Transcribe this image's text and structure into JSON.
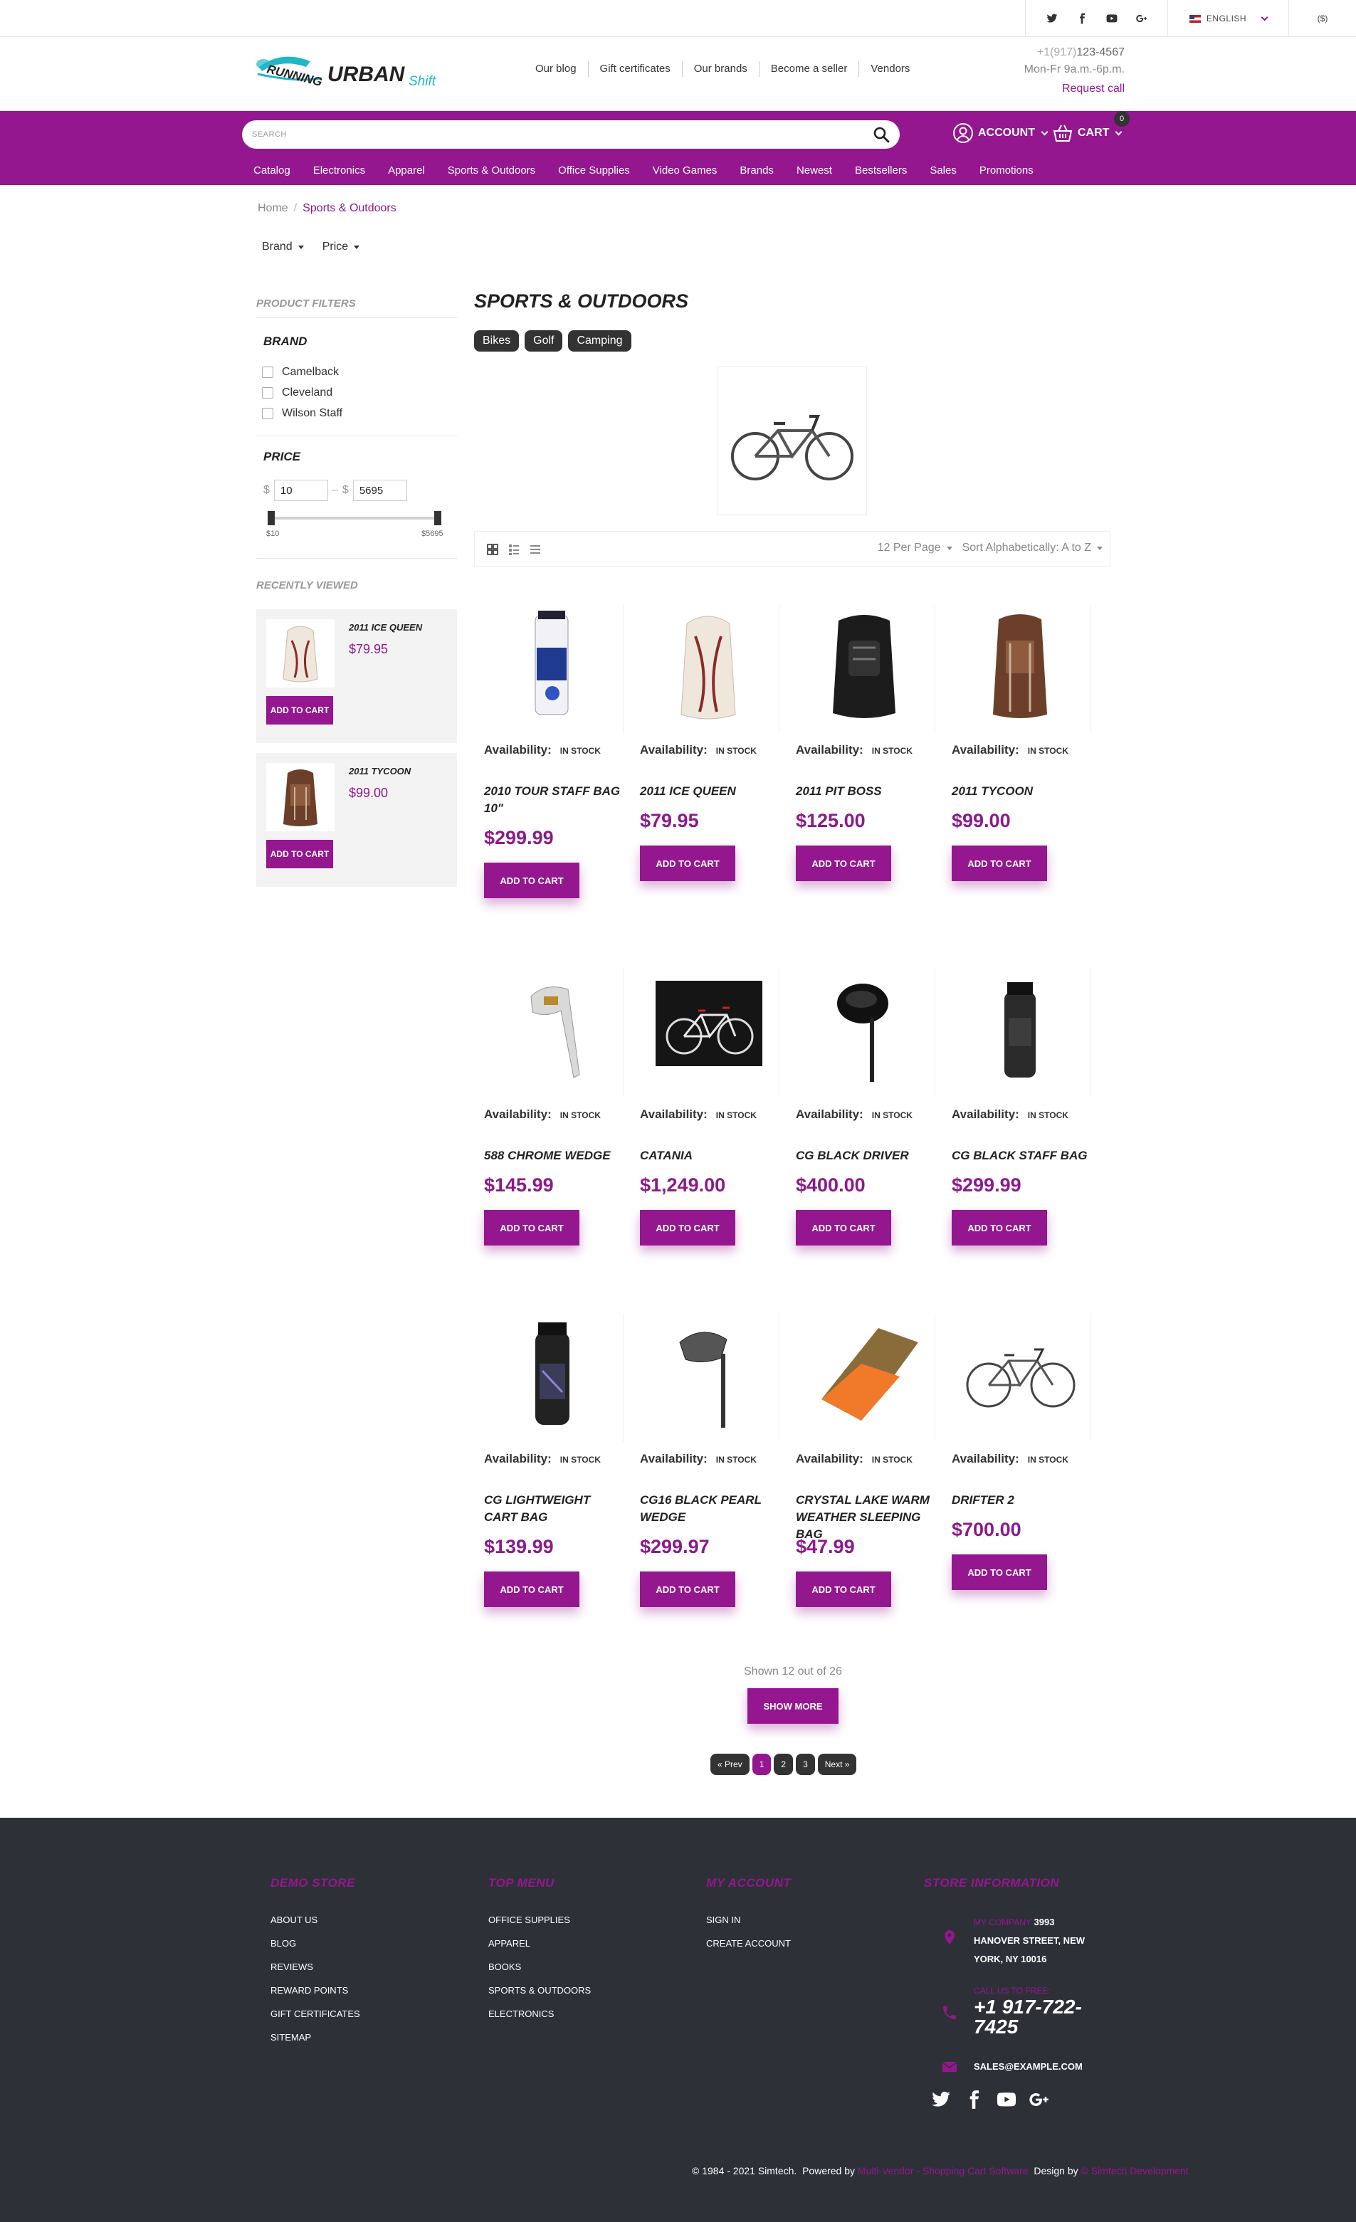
{
  "topbar": {
    "language": "ENGLISH",
    "currency": "($)"
  },
  "header": {
    "logo_word_running": "RUNNING",
    "logo_word_urban": "URBAN",
    "logo_word_shift": "Shift",
    "links": [
      "Our blog",
      "Gift certificates",
      "Our brands",
      "Become a seller",
      "Vendors"
    ],
    "phone_code": "+1(917)",
    "phone_number": "123-4567",
    "hours": "Mon-Fr 9a.m.-6p.m.",
    "request_call": "Request call"
  },
  "search": {
    "placeholder": "SEARCH"
  },
  "account": {
    "label": "ACCOUNT"
  },
  "cart": {
    "label": "CART",
    "count": "0"
  },
  "nav": [
    "Catalog",
    "Electronics",
    "Apparel",
    "Sports & Outdoors",
    "Office Supplies",
    "Video Games",
    "Brands",
    "Newest",
    "Bestsellers",
    "Sales",
    "Promotions"
  ],
  "breadcrumb": {
    "home": "Home",
    "separator": "/",
    "current": "Sports & Outdoors"
  },
  "filters_row": {
    "brand": "Brand",
    "price": "Price"
  },
  "sidebar": {
    "product_filters": "PRODUCT FILTERS",
    "brand_title": "BRAND",
    "brands": [
      "Camelback",
      "Cleveland",
      "Wilson Staff"
    ],
    "price_title": "PRICE",
    "currency_symbol": "$",
    "price_dash": "–",
    "price_min": "10",
    "price_max": "5695",
    "price_min_label": "$10",
    "price_max_label": "$5695",
    "recently_viewed": "RECENTLY VIEWED",
    "recent": [
      {
        "name": "2011 ICE QUEEN",
        "price": "$79.95",
        "button": "ADD TO CART"
      },
      {
        "name": "2011 TYCOON",
        "price": "$99.00",
        "button": "ADD TO CART"
      }
    ]
  },
  "category": {
    "title": "SPORTS & OUTDOORS",
    "subcategories": [
      "Bikes",
      "Golf",
      "Camping"
    ]
  },
  "toolbar": {
    "per_page": "12 Per Page",
    "sort": "Sort Alphabetically: A to Z"
  },
  "availability_label": "Availability:",
  "products": [
    {
      "name": "2010 TOUR STAFF BAG 10\"",
      "price": "$299.99",
      "stock": "IN STOCK",
      "button": "ADD TO CART"
    },
    {
      "name": "2011 ICE QUEEN",
      "price": "$79.95",
      "stock": "IN STOCK",
      "button": "ADD TO CART"
    },
    {
      "name": "2011 PIT BOSS",
      "price": "$125.00",
      "stock": "IN STOCK",
      "button": "ADD TO CART"
    },
    {
      "name": "2011 TYCOON",
      "price": "$99.00",
      "stock": "IN STOCK",
      "button": "ADD TO CART"
    },
    {
      "name": "588 CHROME WEDGE",
      "price": "$145.99",
      "stock": "IN STOCK",
      "button": "ADD TO CART"
    },
    {
      "name": "CATANIA",
      "price": "$1,249.00",
      "stock": "IN STOCK",
      "button": "ADD TO CART"
    },
    {
      "name": "CG BLACK DRIVER",
      "price": "$400.00",
      "stock": "IN STOCK",
      "button": "ADD TO CART"
    },
    {
      "name": "CG BLACK STAFF BAG",
      "price": "$299.99",
      "stock": "IN STOCK",
      "button": "ADD TO CART"
    },
    {
      "name": "CG LIGHTWEIGHT CART BAG",
      "price": "$139.99",
      "stock": "IN STOCK",
      "button": "ADD TO CART"
    },
    {
      "name": "CG16 BLACK PEARL WEDGE",
      "price": "$299.97",
      "stock": "IN STOCK",
      "button": "ADD TO CART"
    },
    {
      "name": "CRYSTAL LAKE WARM WEATHER SLEEPING BAG",
      "price": "$47.99",
      "stock": "IN STOCK",
      "button": "ADD TO CART"
    },
    {
      "name": "DRIFTER 2",
      "price": "$700.00",
      "stock": "IN STOCK",
      "button": "ADD TO CART"
    }
  ],
  "pagination": {
    "shown": "Shown 12 out of 26",
    "show_more": "SHOW MORE",
    "prev": "« Prev",
    "pages": [
      "1",
      "2",
      "3"
    ],
    "next": "Next »"
  },
  "footer": {
    "col1_title": "DEMO STORE",
    "col1_links": [
      "ABOUT US",
      "BLOG",
      "REVIEWS",
      "REWARD POINTS",
      "GIFT CERTIFICATES",
      "SITEMAP"
    ],
    "col2_title": "TOP MENU",
    "col2_links": [
      "OFFICE SUPPLIES",
      "APPAREL",
      "BOOKS",
      "SPORTS & OUTDOORS",
      "ELECTRONICS"
    ],
    "col3_title": "MY ACCOUNT",
    "col3_links": [
      "SIGN IN",
      "CREATE ACCOUNT"
    ],
    "col4_title": "STORE INFORMATION",
    "company_label": "MY COMPANY",
    "address_line1": "3993",
    "address_line2": "HANOVER STREET, NEW",
    "address_line3": "YORK, NY 10016",
    "call_label": "CALL US TO FREE:",
    "phone_line1": "+1 917-722-",
    "phone_line2": "7425",
    "email": "SALES@EXAMPLE.COM",
    "copyright": "© 1984 - 2021 Simtech.",
    "powered_by": "Powered by",
    "powered_link": "Multi-Vendor - Shopping Cart Software",
    "design_by": "Design by",
    "design_link": "© Simtech Development"
  },
  "colors": {
    "brand_purple": "#94178f",
    "dark": "#2e3038",
    "cyan_accent": "#1fb8c9"
  }
}
